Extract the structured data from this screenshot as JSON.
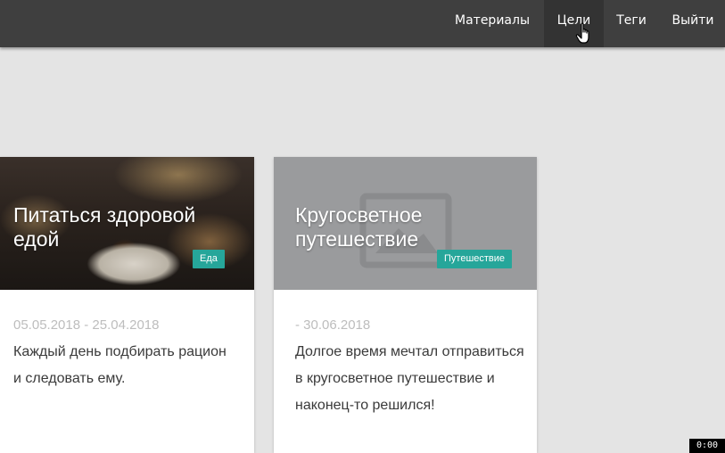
{
  "nav": {
    "items": [
      {
        "label": "Материалы"
      },
      {
        "label": "Цели",
        "active": true
      },
      {
        "label": "Теги"
      },
      {
        "label": "Выйти"
      }
    ]
  },
  "cards": [
    {
      "title": "Питаться здоровой едой",
      "tag": "Еда",
      "dates": "05.05.2018 - 25.04.2018",
      "description": "Каждый день подбирать рацион и следовать ему."
    },
    {
      "title": "Кругосветное путешествие",
      "tag": "Путешествие",
      "dates": "- 30.06.2018",
      "description": "Долгое время мечтал отправиться в кругосветное путешествие и наконец-то решился!"
    }
  ],
  "colors": {
    "navbar": "#3f3f3f",
    "nav_active": "#333333",
    "page_background": "#e4e4e4",
    "tag": "#26a69a",
    "date_text": "#bdbdbd"
  },
  "icons": {
    "cursor": "hand-pointer-icon",
    "image_placeholder": "image-placeholder-icon"
  },
  "recording_timer": "0:00"
}
